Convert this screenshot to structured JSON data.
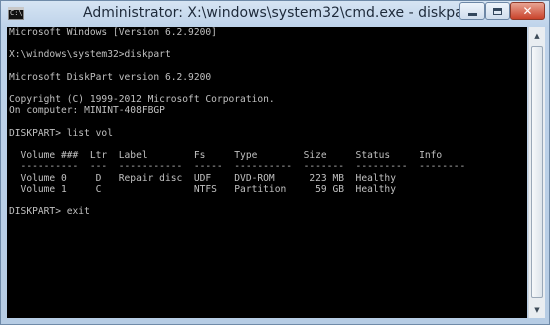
{
  "window": {
    "title": "Administrator: X:\\windows\\system32\\cmd.exe - diskpart",
    "icon_text": "C:\\",
    "controls": {
      "minimize_icon": "minimize-icon",
      "maximize_icon": "maximize-icon",
      "close_glyph": "✕"
    }
  },
  "console": {
    "lines": [
      "Microsoft Windows [Version 6.2.9200]",
      "",
      "X:\\windows\\system32>diskpart",
      "",
      "Microsoft DiskPart version 6.2.9200",
      "",
      "Copyright (C) 1999-2012 Microsoft Corporation.",
      "On computer: MININT-408FBGP",
      "",
      "DISKPART> list vol",
      "",
      "  Volume ###  Ltr  Label        Fs     Type        Size     Status     Info",
      "  ----------  ---  -----------  -----  ----------  -------  ---------  --------",
      "  Volume 0     D   Repair disc  UDF    DVD-ROM      223 MB  Healthy",
      "  Volume 1     C                NTFS   Partition     59 GB  Healthy",
      "",
      "DISKPART> exit"
    ],
    "text_color": "#c0c0c0",
    "background": "#000000"
  },
  "scrollbar": {
    "up_arrow": "▲",
    "down_arrow": "▼"
  }
}
